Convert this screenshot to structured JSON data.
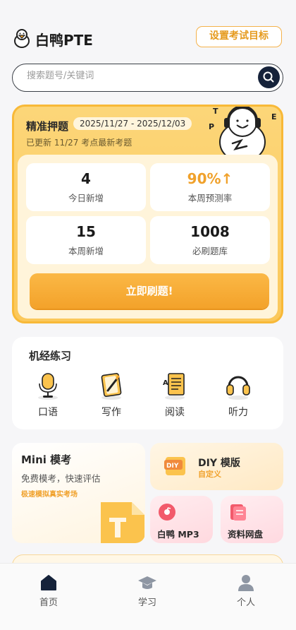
{
  "header": {
    "brand": "白鸭PTE",
    "goal_button": "设置考试目标",
    "logo_icon": "duck-logo-icon"
  },
  "search": {
    "placeholder": "搜索题号/关键词",
    "icon": "search-icon"
  },
  "predict_card": {
    "title": "精准押题",
    "date_range": "2025/11/27 - 2025/12/03",
    "updated": "已更新 11/27 考点最新考题",
    "stats": [
      {
        "value": "4",
        "label": "今日新增"
      },
      {
        "value": "90%↑",
        "label": "本周预测率"
      },
      {
        "value": "15",
        "label": "本周新增"
      },
      {
        "value": "1008",
        "label": "必刷题库"
      }
    ],
    "cta": "立即刷题!"
  },
  "practice": {
    "title": "机经练习",
    "items": [
      {
        "label": "口语",
        "icon": "microphone-icon"
      },
      {
        "label": "写作",
        "icon": "notebook-pen-icon"
      },
      {
        "label": "阅读",
        "icon": "document-read-icon"
      },
      {
        "label": "听力",
        "icon": "headphones-icon"
      }
    ]
  },
  "mini_mock": {
    "title": "Mini 模考",
    "subtitle": "免费模考，快速评估",
    "tag": "极速模拟真实考场"
  },
  "diy": {
    "title": "DIY 模版",
    "subtitle": "自定义",
    "icon_text": "DIY"
  },
  "mp3": {
    "label": "白鸭 MP3"
  },
  "disk": {
    "label": "资料网盘"
  },
  "tabbar": [
    {
      "label": "首页",
      "icon": "home-icon"
    },
    {
      "label": "学习",
      "icon": "graduation-cap-icon"
    },
    {
      "label": "个人",
      "icon": "user-icon"
    }
  ],
  "colors": {
    "accent": "#f3a22a",
    "card_bg": "#fcd679",
    "dark": "#15223a"
  }
}
